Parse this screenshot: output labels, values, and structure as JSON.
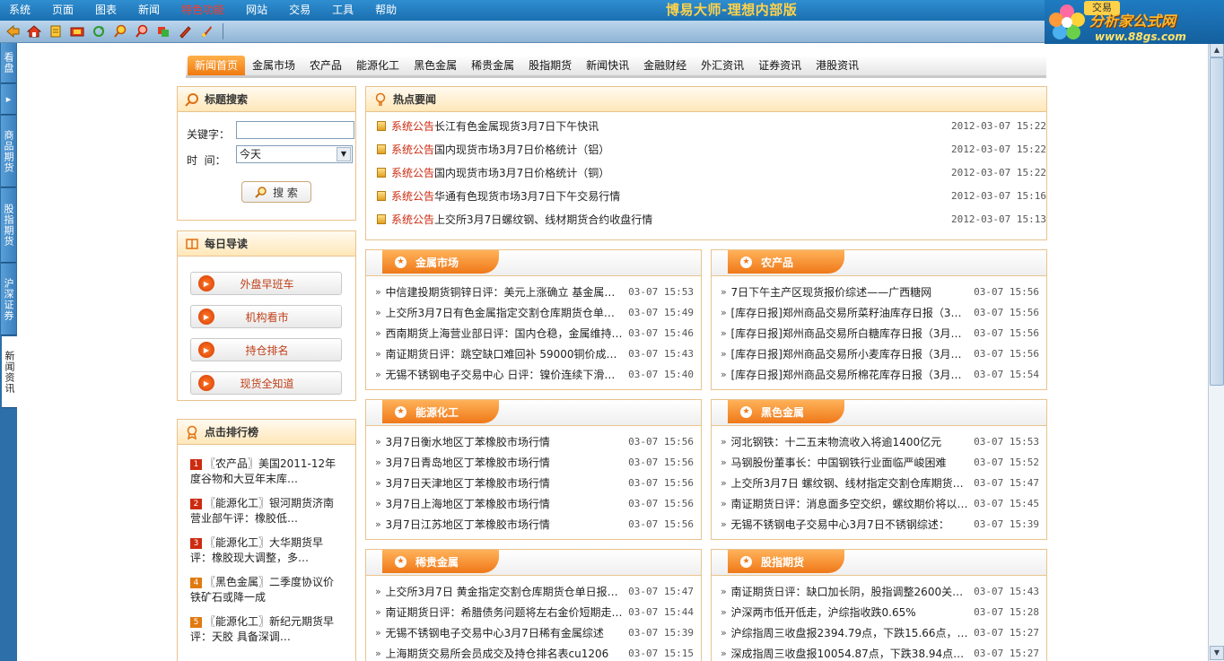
{
  "menu": [
    "系统",
    "页面",
    "图表",
    "新闻",
    "特色功能",
    "网站",
    "交易",
    "工具",
    "帮助"
  ],
  "menu_active": "特色功能",
  "app_title": "博易大师-理想内部版",
  "logo": {
    "brand": "分析家公式网",
    "url": "www.88gs.com",
    "mini_btn": "交易"
  },
  "left_tabs": [
    "看盘",
    "商品期货",
    "股指期货",
    "沪深证券",
    "新闻资讯"
  ],
  "left_tab_arrow": "▸",
  "nav_tabs": [
    "新闻首页",
    "金属市场",
    "农产品",
    "能源化工",
    "黑色金属",
    "稀贵金属",
    "股指期货",
    "新闻快讯",
    "金融财经",
    "外汇资讯",
    "证券资讯",
    "港股资讯"
  ],
  "search": {
    "title": "标题搜索",
    "keyword_label": "关键字：",
    "time_label": "时  间：",
    "time_value": "今天",
    "button": "搜 索"
  },
  "guide": {
    "title": "每日导读",
    "items": [
      "外盘早班车",
      "机构看市",
      "持仓排名",
      "现货全知道"
    ]
  },
  "rank": {
    "title": "点击排行榜",
    "items": [
      {
        "num": "1",
        "text": "〖农产品〗美国2011-12年度谷物和大豆年末库…"
      },
      {
        "num": "2",
        "text": "〖能源化工〗银河期货济南营业部午评：橡胶低…"
      },
      {
        "num": "3",
        "text": "〖能源化工〗大华期货早评：橡胶现大调整，多…"
      },
      {
        "num": "4",
        "text": "〖黑色金属〗二季度协议价铁矿石或降一成"
      },
      {
        "num": "5",
        "text": "〖能源化工〗新纪元期货早评：天胶 具备深调…"
      }
    ]
  },
  "hot": {
    "title": "热点要闻",
    "items": [
      {
        "tag": "系统公告",
        "text": "长江有色金属现货3月7日下午快讯",
        "time": "2012-03-07 15:22"
      },
      {
        "tag": "系统公告",
        "text": "国内现货市场3月7日价格统计（铝）",
        "time": "2012-03-07 15:22"
      },
      {
        "tag": "系统公告",
        "text": "国内现货市场3月7日价格统计（铜）",
        "time": "2012-03-07 15:22"
      },
      {
        "tag": "系统公告",
        "text": "华通有色现货市场3月7日下午交易行情",
        "time": "2012-03-07 15:16"
      },
      {
        "tag": "系统公告",
        "text": "上交所3月7日螺纹钢、线材期货合约收盘行情",
        "time": "2012-03-07 15:13"
      }
    ]
  },
  "categories": [
    {
      "title": "金属市场",
      "items": [
        {
          "t": "中信建投期货铜锌日评：美元上涨确立 基金属…",
          "time": "03-07 15:53"
        },
        {
          "t": "上交所3月7日有色金属指定交割仓库期货仓单日…",
          "time": "03-07 15:49"
        },
        {
          "t": "西南期货上海营业部日评：国内仓稳，金属维持…",
          "time": "03-07 15:46"
        },
        {
          "t": "南证期货日评：跳空缺口难回补 59000铜价成…",
          "time": "03-07 15:43"
        },
        {
          "t": "无锡不锈钢电子交易中心 日评：镍价连续下滑…",
          "time": "03-07 15:40"
        }
      ]
    },
    {
      "title": "农产品",
      "items": [
        {
          "t": "7日下午主产区现货报价综述——广西糖网",
          "time": "03-07 15:56"
        },
        {
          "t": "[库存日报]郑州商品交易所菜籽油库存日报（3…",
          "time": "03-07 15:56"
        },
        {
          "t": "[库存日报]郑州商品交易所白糖库存日报（3月…",
          "time": "03-07 15:56"
        },
        {
          "t": "[库存日报]郑州商品交易所小麦库存日报（3月…",
          "time": "03-07 15:56"
        },
        {
          "t": "[库存日报]郑州商品交易所棉花库存日报（3月…",
          "time": "03-07 15:54"
        }
      ]
    },
    {
      "title": "能源化工",
      "items": [
        {
          "t": "3月7日衡水地区丁苯橡胶市场行情",
          "time": "03-07 15:56"
        },
        {
          "t": "3月7日青岛地区丁苯橡胶市场行情",
          "time": "03-07 15:56"
        },
        {
          "t": "3月7日天津地区丁苯橡胶市场行情",
          "time": "03-07 15:56"
        },
        {
          "t": "3月7日上海地区丁苯橡胶市场行情",
          "time": "03-07 15:56"
        },
        {
          "t": "3月7日江苏地区丁苯橡胶市场行情",
          "time": "03-07 15:56"
        }
      ]
    },
    {
      "title": "黑色金属",
      "items": [
        {
          "t": "河北钢铁：十二五末物流收入将逾1400亿元",
          "time": "03-07 15:53"
        },
        {
          "t": "马钢股份董事长：中国钢铁行业面临严峻困难",
          "time": "03-07 15:52"
        },
        {
          "t": "上交所3月7日 螺纹钢、线材指定交割仓库期货仓…",
          "time": "03-07 15:47"
        },
        {
          "t": "南证期货日评：消息面多空交织，螺纹期价将以…",
          "time": "03-07 15:45"
        },
        {
          "t": "无锡不锈钢电子交易中心3月7日不锈钢综述：",
          "time": "03-07 15:39"
        }
      ]
    },
    {
      "title": "稀贵金属",
      "items": [
        {
          "t": "上交所3月7日 黄金指定交割仓库期货仓单日报…",
          "time": "03-07 15:47"
        },
        {
          "t": "南证期货日评：希腊债务问题将左右金价短期走…",
          "time": "03-07 15:44"
        },
        {
          "t": "无锡不锈钢电子交易中心3月7日稀有金属综述",
          "time": "03-07 15:39"
        },
        {
          "t": "上海期货交易所会员成交及持仓排名表cu1206",
          "time": "03-07 15:15"
        }
      ]
    },
    {
      "title": "股指期货",
      "items": [
        {
          "t": "南证期货日评：缺口加长阴，股指调整2600关口…",
          "time": "03-07 15:43"
        },
        {
          "t": "沪深两市低开低走，沪综指收跌0.65%",
          "time": "03-07 15:28"
        },
        {
          "t": "沪综指周三收盘报2394.79点，下跌15.66点，跌…",
          "time": "03-07 15:27"
        },
        {
          "t": "深成指周三收盘报10054.87点，下跌38.94点，…",
          "time": "03-07 15:27"
        }
      ]
    }
  ],
  "list_bullet": "»",
  "colors": {
    "menubar": "#1f7bc1",
    "accent": "#ef7818",
    "border": "#e9c38d",
    "tag_red": "#cc2b10"
  }
}
